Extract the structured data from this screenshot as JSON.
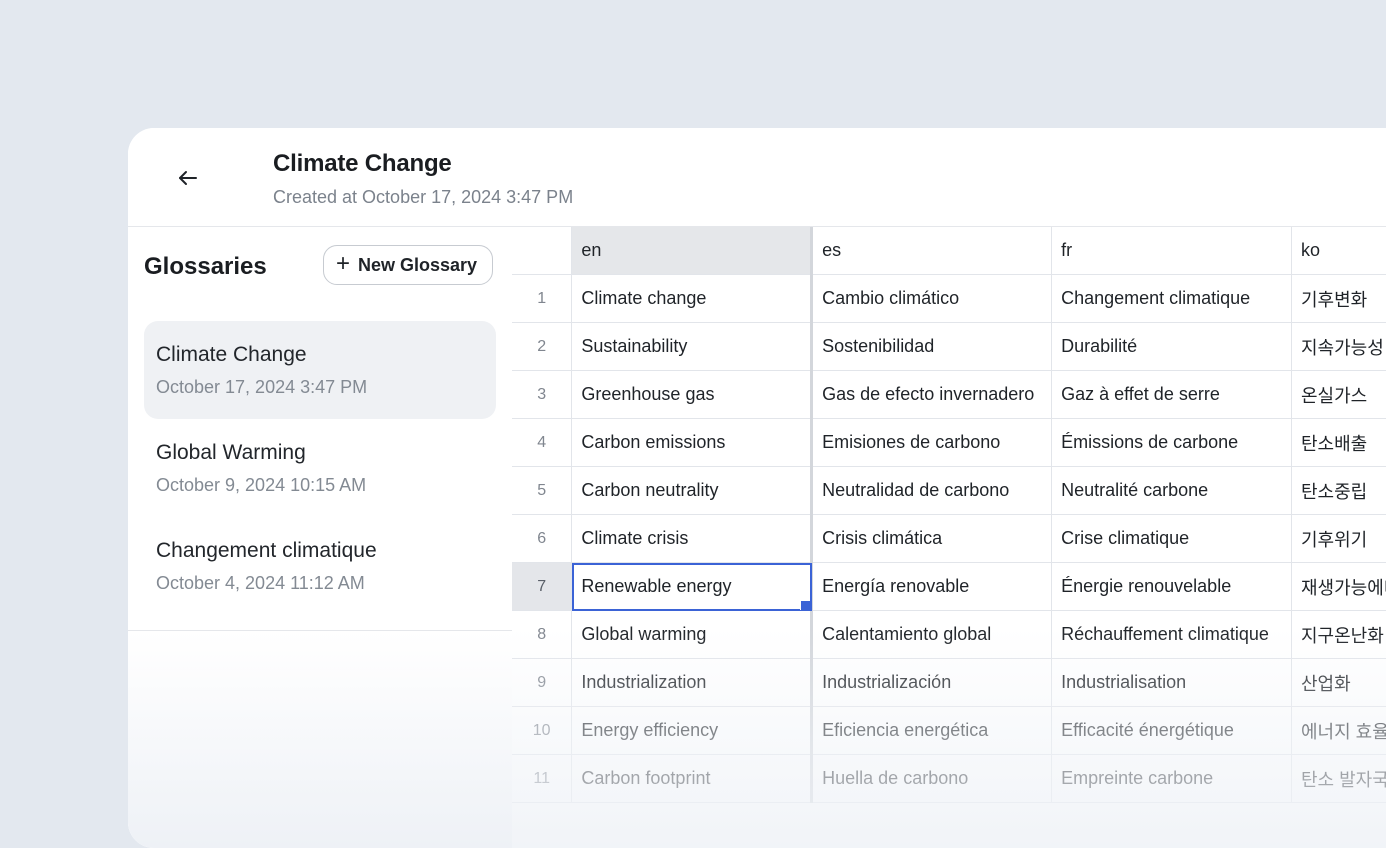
{
  "header": {
    "title": "Climate Change",
    "subtitle": "Created at October 17, 2024 3:47 PM"
  },
  "sidebar": {
    "title": "Glossaries",
    "new_button": "New Glossary",
    "items": [
      {
        "name": "Climate Change",
        "date": "October 17, 2024 3:47 PM"
      },
      {
        "name": "Global Warming",
        "date": "October 9, 2024 10:15 AM"
      },
      {
        "name": "Changement climatique",
        "date": "October 4, 2024 11:12 AM"
      }
    ]
  },
  "grid": {
    "columns": [
      "en",
      "es",
      "fr",
      "ko"
    ],
    "rows": [
      {
        "num": "1",
        "en": "Climate change",
        "es": "Cambio climático",
        "fr": "Changement climatique",
        "ko": "기후변화"
      },
      {
        "num": "2",
        "en": "Sustainability",
        "es": "Sostenibilidad",
        "fr": "Durabilité",
        "ko": "지속가능성"
      },
      {
        "num": "3",
        "en": "Greenhouse gas",
        "es": "Gas de efecto invernadero",
        "fr": "Gaz à effet de serre",
        "ko": "온실가스"
      },
      {
        "num": "4",
        "en": "Carbon emissions",
        "es": "Emisiones de carbono",
        "fr": "Émissions de carbone",
        "ko": "탄소배출"
      },
      {
        "num": "5",
        "en": "Carbon neutrality",
        "es": "Neutralidad de carbono",
        "fr": "Neutralité carbone",
        "ko": "탄소중립"
      },
      {
        "num": "6",
        "en": "Climate crisis",
        "es": "Crisis climática",
        "fr": "Crise climatique",
        "ko": "기후위기"
      },
      {
        "num": "7",
        "en": "Renewable energy",
        "es": "Energía renovable",
        "fr": "Énergie renouvelable",
        "ko": "재생가능에너지"
      },
      {
        "num": "8",
        "en": "Global warming",
        "es": "Calentamiento global",
        "fr": "Réchauffement climatique",
        "ko": "지구온난화"
      },
      {
        "num": "9",
        "en": "Industrialization",
        "es": "Industrialización",
        "fr": "Industrialisation",
        "ko": "산업화"
      },
      {
        "num": "10",
        "en": "Energy efficiency",
        "es": "Eficiencia energética",
        "fr": "Efficacité énergétique",
        "ko": "에너지 효율"
      },
      {
        "num": "11",
        "en": "Carbon footprint",
        "es": "Huella de carbono",
        "fr": "Empreinte carbone",
        "ko": "탄소 발자국"
      }
    ]
  },
  "colors": {
    "background": "#e3e8ef",
    "accent": "#3b63d6",
    "active_item": "#eff1f4"
  }
}
